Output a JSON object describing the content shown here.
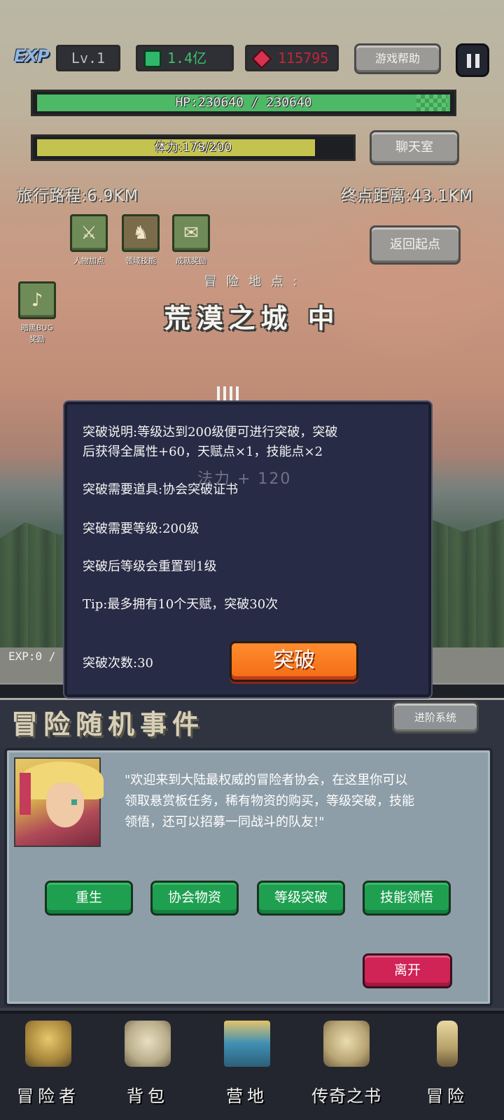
{
  "hud": {
    "exp_logo": "EXP",
    "level": "Lv.1",
    "gems": "1.4亿",
    "rubies": "115795",
    "help_button": "游戏帮助",
    "hp_text": "HP:230640 / 230640",
    "hp_ratio": 1.0,
    "stamina_text": "体力:178/200",
    "stamina_ratio": 0.89,
    "chat_button": "聊天室",
    "travel_distance": "旅行路程:6.9KM",
    "destination_distance": "终点距离:43.1KM",
    "return_button": "返回起点"
  },
  "quick_icons": [
    {
      "label": "人物加点",
      "icon": "crossed-swords-icon"
    },
    {
      "label": "领域技能",
      "icon": "warrior-icon"
    },
    {
      "label": "成就奖励",
      "icon": "scroll-icon"
    }
  ],
  "bonus_icon": {
    "label_line1": "暗黑BUG",
    "label_line2": "奖励",
    "icon": "horn-icon"
  },
  "adventure": {
    "location_label": "冒 险 地 点 :",
    "location_name": "荒漠之城 中"
  },
  "exp_strip": "EXP:0 /",
  "modal": {
    "desc_line1": "突破说明:等级达到200级便可进行突破，突破",
    "desc_line2": "后获得全属性+60，天赋点×1，技能点×2",
    "ghost_text": "法力 + 120",
    "required_item": "突破需要道具:协会突破证书",
    "required_level": "突破需要等级:200级",
    "reset_note": "突破后等级会重置到1级",
    "tip": "Tip:最多拥有10个天赋，突破30次",
    "break_count": "突破次数:30",
    "break_button": "突破"
  },
  "events": {
    "title": "冒险随机事件",
    "advanced_system_button": "进阶系统",
    "dialog_line1": "\"欢迎来到大陆最权威的冒险者协会，在这里你可以",
    "dialog_line2": "领取悬赏板任务，稀有物资的购买，等级突破，技能",
    "dialog_line3": "领悟，还可以招募一同战斗的队友!\"",
    "buttons": [
      "重生",
      "协会物资",
      "等级突破",
      "技能领悟"
    ],
    "leave_button": "离开"
  },
  "nav": [
    {
      "label": "冒险者",
      "icon": "helmet-icon"
    },
    {
      "label": "背包",
      "icon": "backpack-icon"
    },
    {
      "label": "营地",
      "icon": "banner-icon"
    },
    {
      "label": "传奇之书",
      "icon": "book-icon"
    },
    {
      "label": "冒险",
      "icon": "sword-icon"
    }
  ],
  "colors": {
    "hp": "#4db865",
    "stamina": "#c4c34f",
    "modal_bg": "#272b45",
    "break_button": "#f36c15",
    "green_button": "#1ea050",
    "leave_button": "#d02356"
  }
}
